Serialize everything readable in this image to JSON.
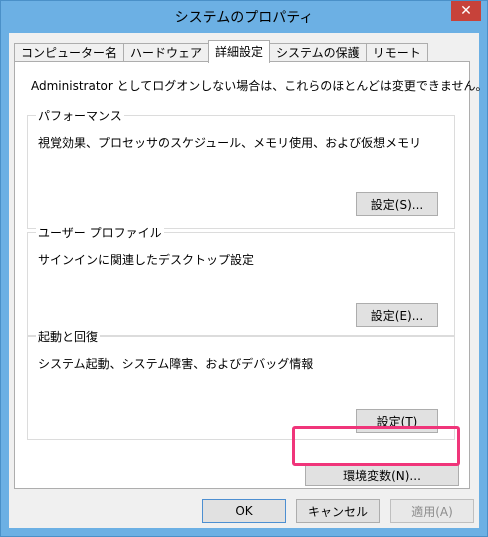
{
  "window": {
    "title": "システムのプロパティ",
    "close_glyph": "✕"
  },
  "tabs": [
    {
      "label": "コンピューター名",
      "active": false
    },
    {
      "label": "ハードウェア",
      "active": false
    },
    {
      "label": "詳細設定",
      "active": true
    },
    {
      "label": "システムの保護",
      "active": false
    },
    {
      "label": "リモート",
      "active": false
    }
  ],
  "advanced": {
    "intro": "Administrator としてログオンしない場合は、これらのほとんどは変更できません。",
    "performance": {
      "title": "パフォーマンス",
      "description": "視覚効果、プロセッサのスケジュール、メモリ使用、および仮想メモリ",
      "button": "設定(S)..."
    },
    "user_profiles": {
      "title": "ユーザー プロファイル",
      "description": "サインインに関連したデスクトップ設定",
      "button": "設定(E)..."
    },
    "startup_recovery": {
      "title": "起動と回復",
      "description": "システム起動、システム障害、およびデバッグ情報",
      "button": "設定(T)"
    },
    "env_vars_button": "環境変数(N)..."
  },
  "footer": {
    "ok": "OK",
    "cancel": "キャンセル",
    "apply": "適用(A)"
  },
  "colors": {
    "titlebar": "#6cb0e4",
    "close": "#c7423a",
    "highlight": "#f0357a"
  }
}
